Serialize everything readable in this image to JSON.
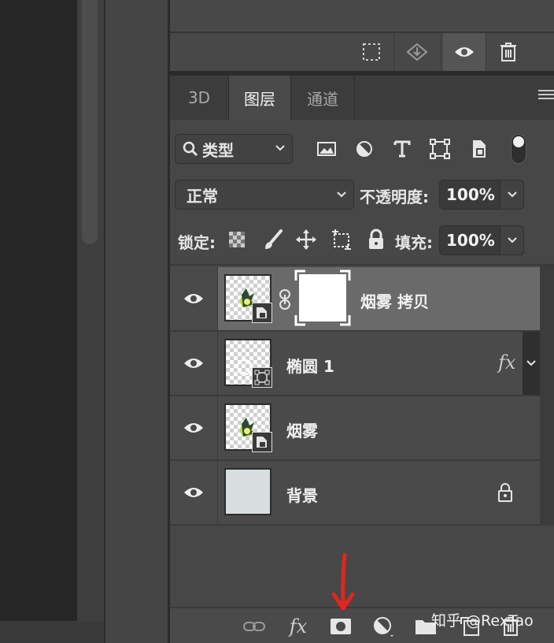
{
  "panel_tabs": [
    {
      "label": "3D",
      "active": false
    },
    {
      "label": "图层",
      "active": true
    },
    {
      "label": "通道",
      "active": false
    }
  ],
  "top_toolbar": {
    "icons": [
      "selection-icon",
      "load-selection-icon",
      "visibility-eye-icon",
      "trash-icon"
    ]
  },
  "filter": {
    "kind_label": "类型",
    "icons": [
      "image-filter-icon",
      "adjustment-filter-icon",
      "type-filter-icon",
      "shape-filter-icon",
      "smart-object-filter-icon"
    ]
  },
  "blend": {
    "mode": "正常",
    "opacity_label": "不透明度:",
    "opacity_value": "100%"
  },
  "lock": {
    "label": "锁定:",
    "fill_label": "填充:",
    "fill_value": "100%"
  },
  "layers": [
    {
      "name": "烟雾 拷贝",
      "selected": true,
      "thumb": "smoke-smart-object",
      "has_mask": true
    },
    {
      "name": "椭圆 1",
      "selected": false,
      "thumb": "shape",
      "fx": "fx"
    },
    {
      "name": "烟雾",
      "selected": false,
      "thumb": "smoke-smart-object"
    },
    {
      "name": "背景",
      "selected": false,
      "thumb": "solid",
      "locked": true
    }
  ],
  "bottom_bar": {
    "icons": [
      "link-layers-icon",
      "fx-icon",
      "add-mask-icon",
      "adjustment-layer-icon",
      "group-folder-icon",
      "new-layer-icon",
      "delete-layer-icon"
    ]
  },
  "watermark": "知乎 @RexTao",
  "colors": {
    "panel_bg": "#474747",
    "selected_row": "#6a6a6a",
    "arrow": "#e0261f"
  }
}
